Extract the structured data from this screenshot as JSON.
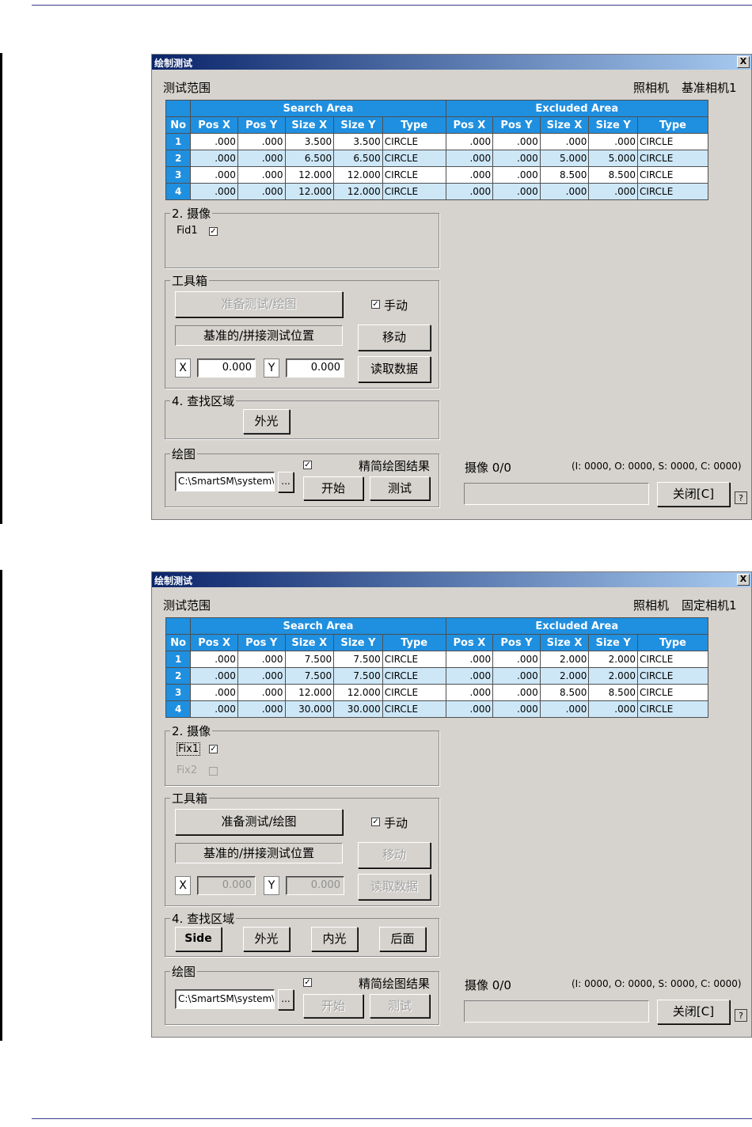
{
  "dialogs": [
    {
      "title": "绘制测试",
      "close_glyph": "X",
      "range_label": "测试范围",
      "camera_label": "照相机",
      "camera_name": "基准相机1",
      "table": {
        "search_area": "Search Area",
        "excluded_area": "Excluded Area",
        "columns": [
          "No",
          "Pos X",
          "Pos Y",
          "Size X",
          "Size Y",
          "Type",
          "Pos X",
          "Pos Y",
          "Size X",
          "Size Y",
          "Type"
        ],
        "rows": [
          [
            "1",
            ".000",
            ".000",
            "3.500",
            "3.500",
            "CIRCLE",
            ".000",
            ".000",
            ".000",
            ".000",
            "CIRCLE"
          ],
          [
            "2",
            ".000",
            ".000",
            "6.500",
            "6.500",
            "CIRCLE",
            ".000",
            ".000",
            "5.000",
            "5.000",
            "CIRCLE"
          ],
          [
            "3",
            ".000",
            ".000",
            "12.000",
            "12.000",
            "CIRCLE",
            ".000",
            ".000",
            "8.500",
            "8.500",
            "CIRCLE"
          ],
          [
            "4",
            ".000",
            ".000",
            "12.000",
            "12.000",
            "CIRCLE",
            ".000",
            ".000",
            ".000",
            ".000",
            "CIRCLE"
          ]
        ]
      },
      "camera_group": {
        "title": "2. 摄像",
        "items": [
          {
            "label": "Fid1",
            "checked": true,
            "disabled": false
          }
        ]
      },
      "toolbox": {
        "title": "工具箱",
        "prepare_button": "准备测试/绘图",
        "prepare_disabled": true,
        "manual_label": "手动",
        "manual_check": "✓",
        "position_label": "基准的/拼接测试位置",
        "move_button": "移动",
        "move_disabled": false,
        "read_button": "读取数据",
        "read_disabled": false,
        "x_label": "X",
        "x_value": "0.000",
        "y_label": "Y",
        "y_value": "0.000",
        "fields_disabled": false
      },
      "search_group": {
        "title": "4. 查找区域",
        "buttons": [
          "外光"
        ]
      },
      "draw_group": {
        "title": "绘图",
        "check": "✓",
        "simplify_label": "精简绘图结果",
        "path": "C:\\SmartSM\\system\\",
        "browse": "...",
        "start_button": "开始",
        "test_button": "测试",
        "buttons_disabled": false
      },
      "status": {
        "camera": "摄像 0/0",
        "counts": "(I: 0000, O: 0000, S: 0000, C: 0000)"
      },
      "close_button": "关闭[C]",
      "help_glyph": "?"
    },
    {
      "title": "绘制测试",
      "close_glyph": "X",
      "range_label": "测试范围",
      "camera_label": "照相机",
      "camera_name": "固定相机1",
      "table": {
        "search_area": "Search Area",
        "excluded_area": "Excluded Area",
        "columns": [
          "No",
          "Pos X",
          "Pos Y",
          "Size X",
          "Size Y",
          "Type",
          "Pos X",
          "Pos Y",
          "Size X",
          "Size Y",
          "Type"
        ],
        "rows": [
          [
            "1",
            ".000",
            ".000",
            "7.500",
            "7.500",
            "CIRCLE",
            ".000",
            ".000",
            "2.000",
            "2.000",
            "CIRCLE"
          ],
          [
            "2",
            ".000",
            ".000",
            "7.500",
            "7.500",
            "CIRCLE",
            ".000",
            ".000",
            "2.000",
            "2.000",
            "CIRCLE"
          ],
          [
            "3",
            ".000",
            ".000",
            "12.000",
            "12.000",
            "CIRCLE",
            ".000",
            ".000",
            "8.500",
            "8.500",
            "CIRCLE"
          ],
          [
            "4",
            ".000",
            ".000",
            "30.000",
            "30.000",
            "CIRCLE",
            ".000",
            ".000",
            ".000",
            ".000",
            "CIRCLE"
          ]
        ]
      },
      "camera_group": {
        "title": "2. 摄像",
        "items": [
          {
            "label": "Fix1",
            "checked": true,
            "disabled": false
          },
          {
            "label": "Fix2",
            "checked": false,
            "disabled": true
          }
        ]
      },
      "toolbox": {
        "title": "工具箱",
        "prepare_button": "准备测试/绘图",
        "prepare_disabled": false,
        "manual_label": "手动",
        "manual_check": "✓",
        "position_label": "基准的/拼接测试位置",
        "move_button": "移动",
        "move_disabled": true,
        "read_button": "读取数据",
        "read_disabled": true,
        "x_label": "X",
        "x_value": "0.000",
        "y_label": "Y",
        "y_value": "0.000",
        "fields_disabled": true
      },
      "search_group": {
        "title": "4. 查找区域",
        "buttons": [
          "Side",
          "外光",
          "内光",
          "后面"
        ]
      },
      "draw_group": {
        "title": "绘图",
        "check": "✓",
        "simplify_label": "精简绘图结果",
        "path": "C:\\SmartSM\\system\\",
        "browse": "...",
        "start_button": "开始",
        "test_button": "测试",
        "buttons_disabled": true
      },
      "status": {
        "camera": "摄像 0/0",
        "counts": "(I: 0000, O: 0000, S: 0000, C: 0000)"
      },
      "close_button": "关闭[C]",
      "help_glyph": "?"
    }
  ],
  "colors": {
    "header_blue": "#1f8fe0",
    "row_alt": "#cde7f7",
    "dialog_bg": "#d6d3ce",
    "title_start": "#0a246a",
    "title_end": "#a6caf0"
  }
}
